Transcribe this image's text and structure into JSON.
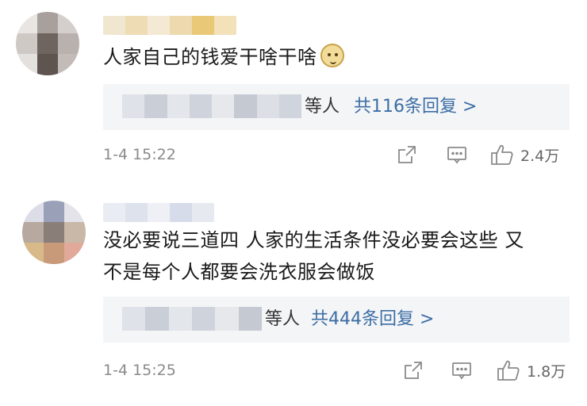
{
  "comments": [
    {
      "text": "人家自己的钱爱干啥干啥",
      "emoji": "doge-emoji",
      "reply_suffix": "等人",
      "reply_link": "共116条回复 >",
      "time": "1-4 15:22",
      "likes": "2.4万"
    },
    {
      "text_line1": "没必要说三道四 人家的生活条件没必要会这些 又",
      "text_line2": "不是每个人都要会洗衣服会做饭",
      "reply_suffix": "等人",
      "reply_link": "共444条回复 >",
      "time": "1-4 15:25",
      "likes": "1.8万"
    }
  ],
  "colors": {
    "link": "#3c6ea5",
    "meta": "#8a8a8a",
    "reply_bg": "#f4f5f7"
  },
  "icons": [
    "share-icon",
    "comment-icon",
    "like-icon"
  ]
}
